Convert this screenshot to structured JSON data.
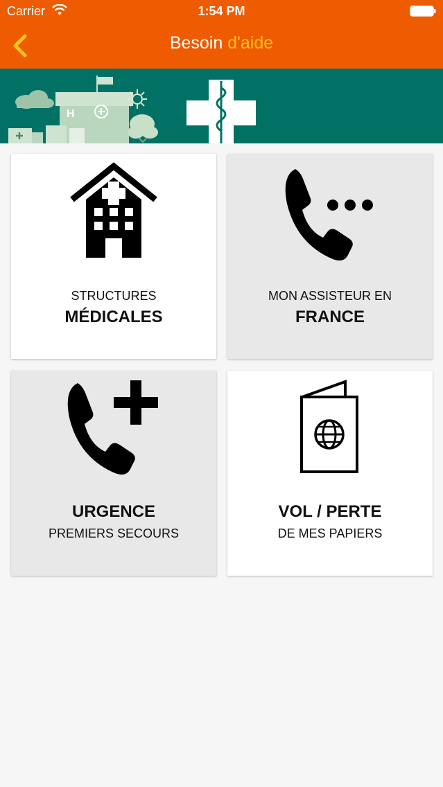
{
  "status_bar": {
    "carrier": "Carrier",
    "time": "1:54 PM"
  },
  "nav": {
    "title_main": "Besoin",
    "title_accent": "d'aide"
  },
  "tiles": [
    {
      "line1": "STRUCTURES",
      "line2": "MÉDICALES",
      "icon": "hospital-icon"
    },
    {
      "line1": "MON ASSISTEUR EN",
      "line2": "FRANCE",
      "icon": "phone-dots-icon"
    },
    {
      "line1": "URGENCE",
      "line2": "PREMIERS SECOURS",
      "icon": "phone-plus-icon"
    },
    {
      "line1": "VOL / PERTE",
      "line2": "DE MES PAPIERS",
      "icon": "passport-icon"
    }
  ],
  "colors": {
    "header": "#ef5b00",
    "title_accent": "#ffc21e",
    "banner": "#007164"
  }
}
